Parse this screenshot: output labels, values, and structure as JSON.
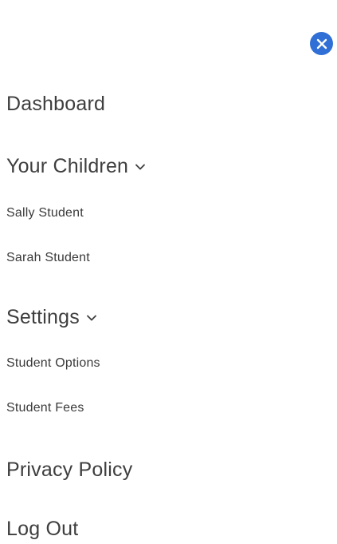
{
  "close_button": {
    "icon": "close-icon",
    "color": "#2f6fd6"
  },
  "nav": {
    "dashboard": "Dashboard",
    "your_children": {
      "label": "Your Children",
      "icon": "chevron-down-icon",
      "items": [
        "Sally Student",
        "Sarah Student"
      ]
    },
    "settings": {
      "label": "Settings",
      "icon": "chevron-down-icon",
      "items": [
        "Student Options",
        "Student Fees"
      ]
    },
    "privacy_policy": "Privacy Policy",
    "log_out": "Log Out"
  }
}
